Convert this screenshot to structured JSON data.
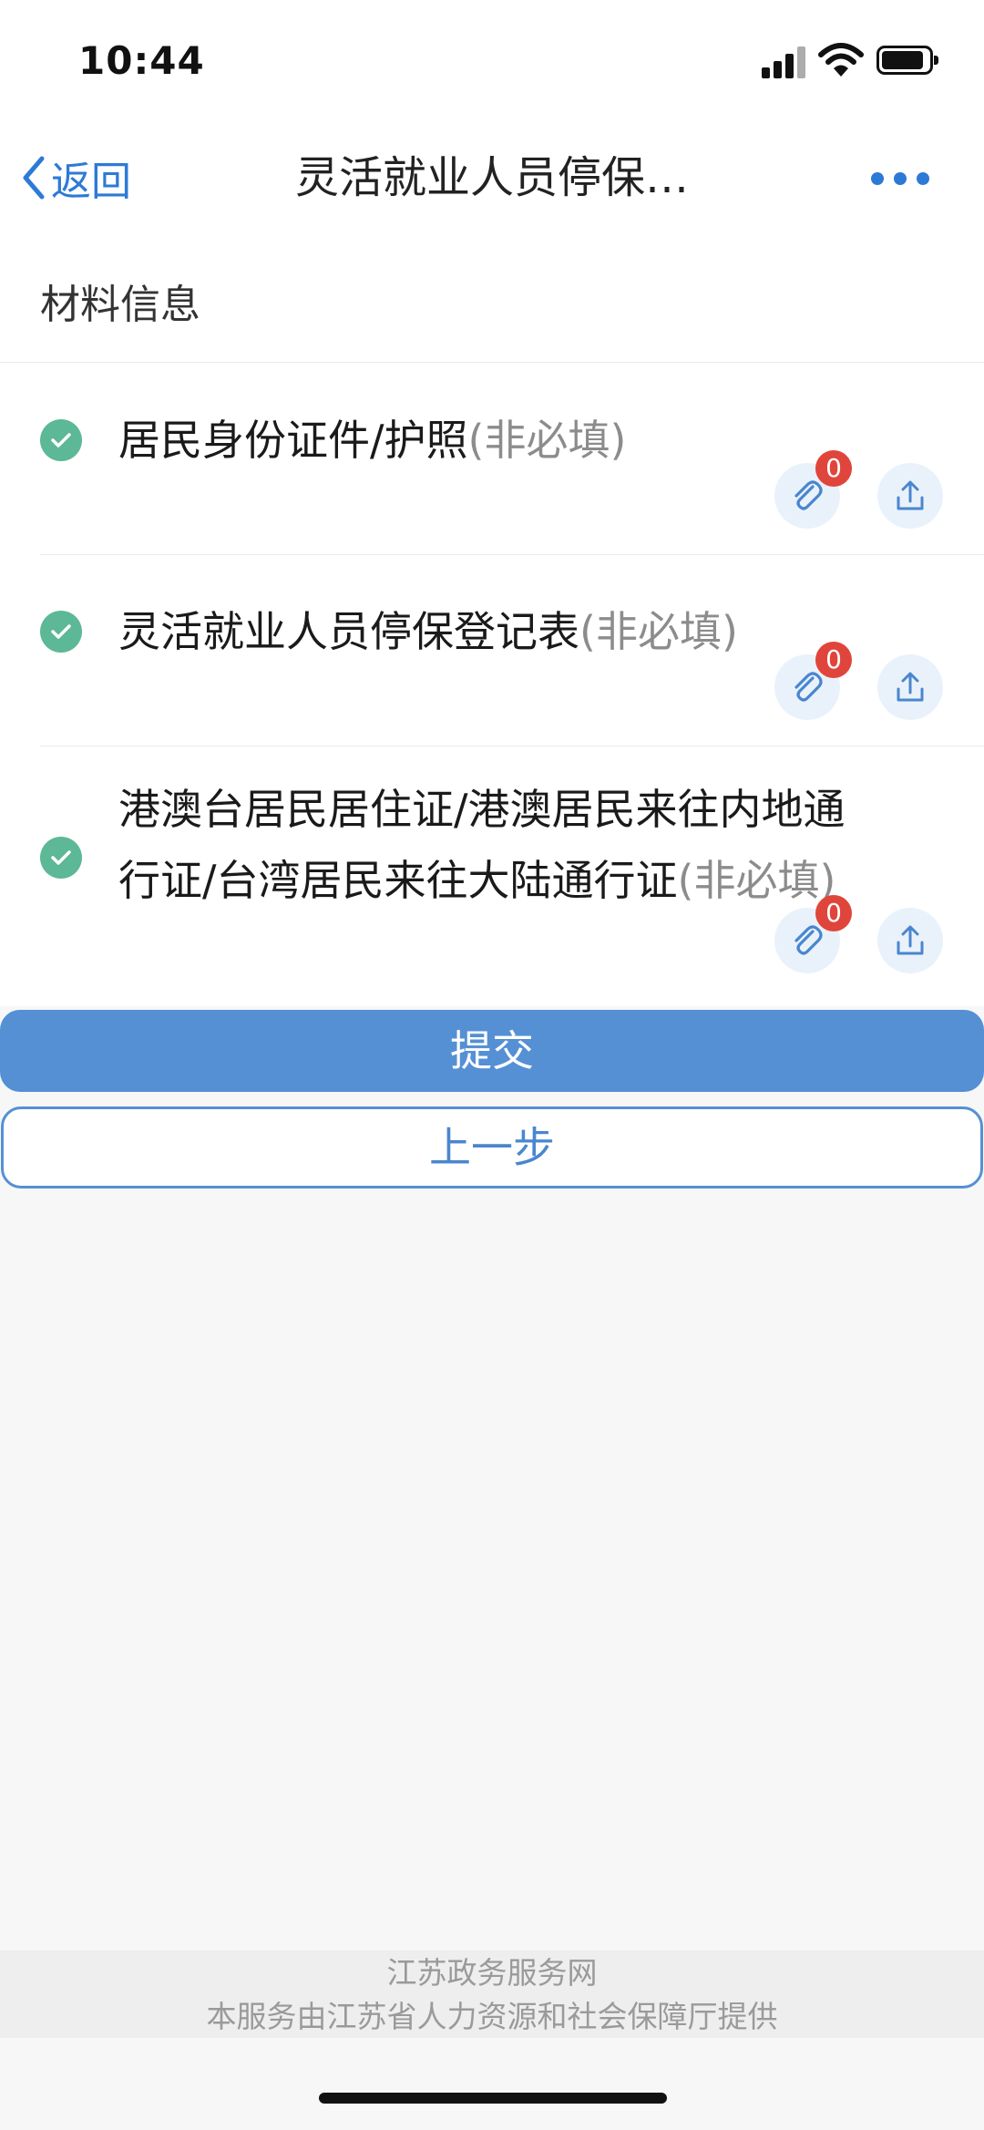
{
  "status_bar": {
    "time": "10:44",
    "battery_level": 0.9
  },
  "nav": {
    "back_label": "返回",
    "title": "灵活就业人员停保…",
    "accent_color": "#2d7ad6"
  },
  "section": {
    "title": "材料信息"
  },
  "materials": {
    "items": [
      {
        "name": "居民身份证件/护照",
        "optional_label": "(非必填)",
        "attachment_count": "0",
        "status": "check-circle-icon"
      },
      {
        "name": "灵活就业人员停保登记表",
        "optional_label": "(非必填)",
        "attachment_count": "0",
        "status": "check-circle-icon"
      },
      {
        "name_line1": "港澳台居民居住证/港澳居民来往内地通",
        "name_line2": "行证/台湾居民来往大陆通行证",
        "optional_label": "(非必填)",
        "attachment_count": "0",
        "status": "check-circle-icon"
      }
    ],
    "check_color": "#5cb896",
    "badge_color": "#e0453b"
  },
  "actions": {
    "submit_label": "提交",
    "prev_label": "上一步",
    "primary_color": "#5590d4"
  },
  "footer": {
    "line1": "江苏政务服务网",
    "line2": "本服务由江苏省人力资源和社会保障厅提供"
  }
}
